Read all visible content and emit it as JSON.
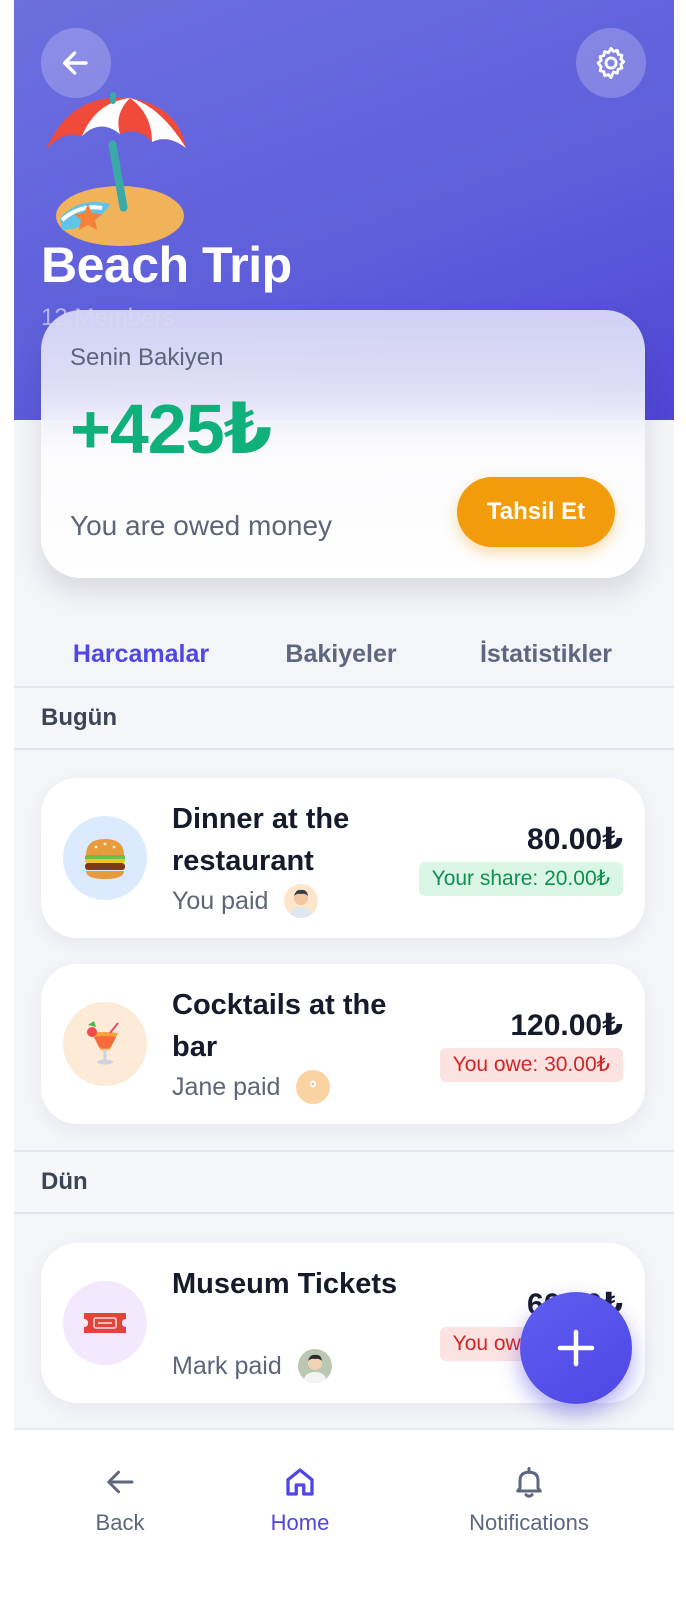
{
  "header": {
    "title": "Beach Trip",
    "members": "12 Members",
    "emoji_icon": "beach-umbrella",
    "gradient_start": "#6c6fdf",
    "gradient_end": "#4f45d6"
  },
  "balance": {
    "label": "Senin Bakiyen",
    "amount": "+425₺",
    "subtitle": "You are owed money",
    "collect_button": "Tahsil Et"
  },
  "tabs": [
    {
      "label": "Harcamalar",
      "active": true
    },
    {
      "label": "Bakiyeler",
      "active": false
    },
    {
      "label": "İstatistikler",
      "active": false
    }
  ],
  "sections": [
    {
      "heading": "Bugün",
      "expenses": [
        {
          "title": "Dinner at the restaurant",
          "icon": "hamburger",
          "paid_by": "You paid",
          "amount": "80.00₺",
          "badge": "Your share: 20.00₺",
          "badge_type": "positive"
        },
        {
          "title": "Cocktails at the bar",
          "icon": "tropical-drink",
          "paid_by": "Jane paid",
          "amount": "120.00₺",
          "badge": "You owe: 30.00₺",
          "badge_type": "negative"
        }
      ]
    },
    {
      "heading": "Dün",
      "expenses": [
        {
          "title": "Museum Tickets",
          "icon": "ticket",
          "paid_by": "Mark paid",
          "amount": "60.00₺",
          "badge": "You owe: 15.00₺",
          "badge_type": "negative"
        }
      ]
    }
  ],
  "bottom_nav": [
    {
      "label": "Back",
      "icon": "arrow-left",
      "active": false
    },
    {
      "label": "Home",
      "icon": "home",
      "active": true
    },
    {
      "label": "Notifications",
      "icon": "bell",
      "active": false
    }
  ],
  "colors": {
    "accent": "#4f46e5",
    "positive": "#10b07a",
    "collect": "#f39c0b",
    "negative": "#d42525"
  }
}
